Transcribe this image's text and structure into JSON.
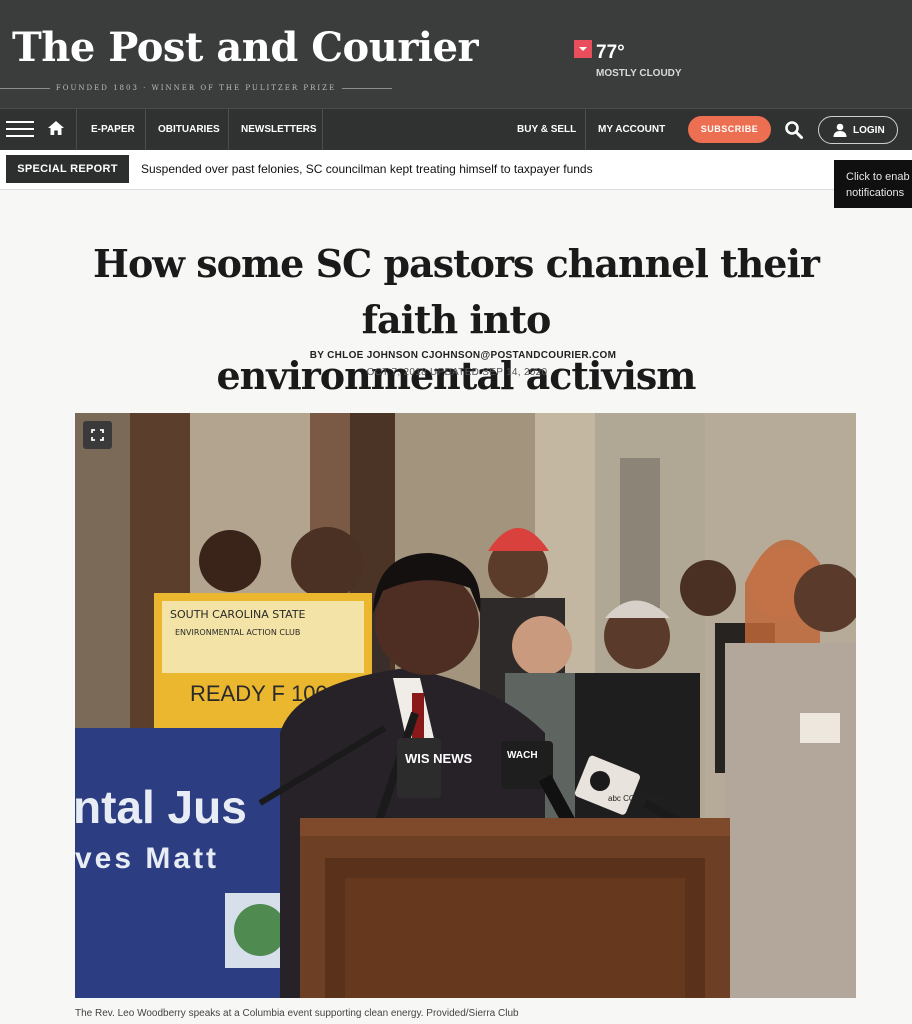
{
  "masthead": {
    "logo": "The Post and Courier",
    "tagline": "FOUNDED 1803 · WINNER OF THE PULITZER PRIZE",
    "weather": {
      "temp": "77°",
      "condition": "MOSTLY CLOUDY"
    }
  },
  "nav": {
    "links": [
      "E-PAPER",
      "OBITUARIES",
      "NEWSLETTERS"
    ],
    "right_links": [
      "BUY & SELL",
      "MY ACCOUNT"
    ],
    "subscribe": "SUBSCRIBE",
    "login": "LOGIN"
  },
  "special_report": {
    "badge": "SPECIAL REPORT",
    "headline": "Suspended over past felonies, SC councilman kept treating himself to taxpayer funds"
  },
  "tooltip": {
    "line1": "Click to enab",
    "line2": "notifications"
  },
  "article": {
    "headline_line1": "How some SC pastors channel their faith into",
    "headline_line2": "environmental activism",
    "byline": "BY CHLOE JOHNSON CJOHNSON@POSTANDCOURIER.COM",
    "dateline": "OCT 7, 2018 UPDATED SEP 14, 2020",
    "photo": {
      "sign_text": "READY F 100",
      "sign_handwriting": "SOUTH CAROLINA STATE UNIVERSITY ENVIRONMENTAL ACTION CLUB",
      "banner_text_1": "ntal Jus",
      "banner_text_2": "ves Matt",
      "mic_label_1": "WIS NEWS",
      "mic_label_2": "WACH",
      "mic_label_3": "abc COLUMBIA"
    },
    "caption": "The Rev. Leo Woodberry speaks at a Columbia event supporting clean energy. Provided/Sierra Club"
  },
  "colors": {
    "masthead_bg": "#3a3d3b",
    "nav_bg": "#2f3230",
    "subscribe": "#ec6f52",
    "weather_flag": "#e84e5b"
  }
}
